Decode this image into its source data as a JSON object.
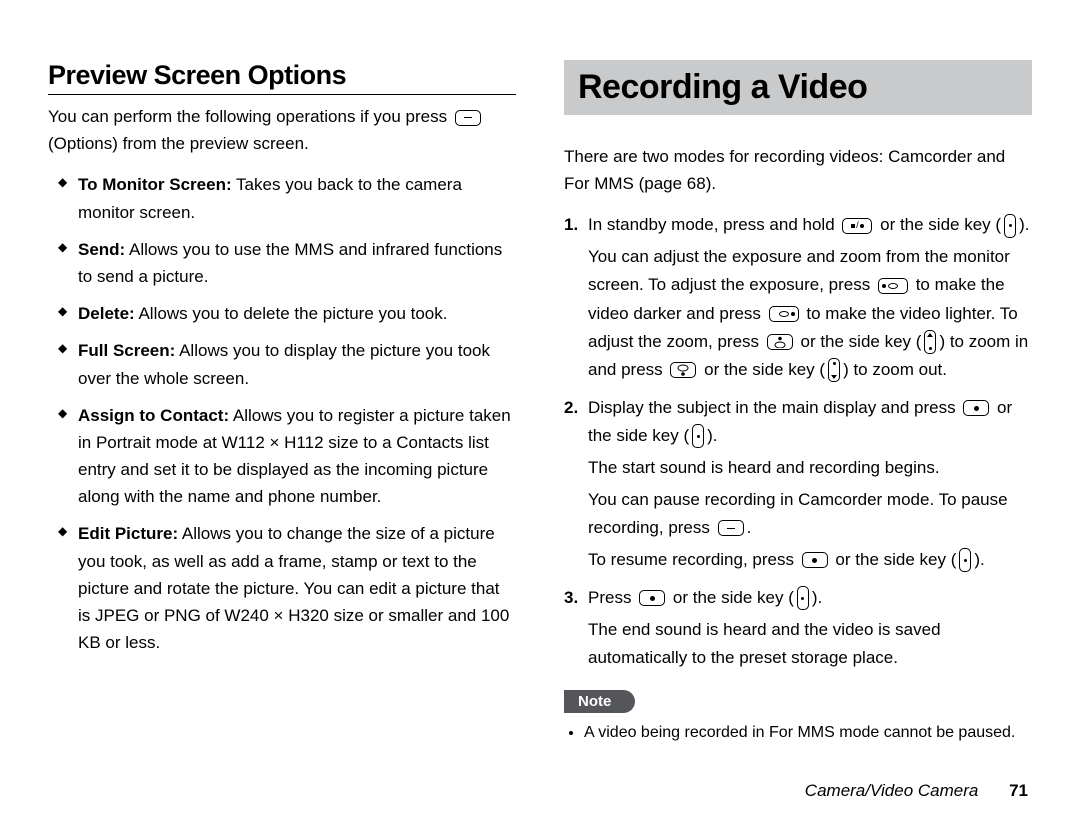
{
  "left": {
    "title": "Preview Screen Options",
    "intro_a": "You can perform the following operations if you press ",
    "intro_b": " (Options) from the preview screen.",
    "items": [
      {
        "label": "To Monitor Screen:",
        "text": " Takes you back to the camera monitor screen."
      },
      {
        "label": "Send:",
        "text": " Allows you to use the MMS and infrared functions to send a picture."
      },
      {
        "label": "Delete:",
        "text": " Allows you to delete the picture you took."
      },
      {
        "label": "Full Screen:",
        "text": " Allows you to display the picture you took over the whole screen."
      },
      {
        "label": "Assign to Contact:",
        "text": " Allows you to register a picture taken in Portrait mode at W112 × H112 size to a Contacts list entry and set it to be displayed as the incoming picture along with the name and phone number."
      },
      {
        "label": "Edit Picture:",
        "text": " Allows you to change the size of a picture you took, as well as add a frame, stamp or text to the picture and rotate the picture. You can edit a picture that is JPEG or PNG of W240 × H320 size or smaller and 100 KB or less."
      }
    ]
  },
  "right": {
    "title": "Recording a Video",
    "intro": "There are two modes for recording videos: Camcorder and For MMS (page 68).",
    "s1_a": "In standby mode, press and hold ",
    "s1_b": " or the side key (",
    "s1_c": ").",
    "s1_p2_a": "You can adjust the exposure and zoom from the monitor screen. To adjust the exposure, press ",
    "s1_p2_b": " to make the video darker and press ",
    "s1_p2_c": " to make the video lighter. To adjust the zoom, press ",
    "s1_p2_d": " or the side key (",
    "s1_p2_e": ") to zoom in and press ",
    "s1_p2_f": " or the side key (",
    "s1_p2_g": ") to zoom out.",
    "s2_a": "Display the subject in the main display and press ",
    "s2_b": " or the side key (",
    "s2_c": ").",
    "s2_p2": "The start sound is heard and recording begins.",
    "s2_p3_a": "You can pause recording in Camcorder mode. To pause recording, press ",
    "s2_p3_b": ".",
    "s2_p4_a": "To resume recording, press ",
    "s2_p4_b": " or the side key (",
    "s2_p4_c": ").",
    "s3_a": "Press ",
    "s3_b": " or the side key (",
    "s3_c": ").",
    "s3_p2": "The end sound is heard and the video is saved automatically to the preset storage place.",
    "note_label": "Note",
    "note_text": "A video being recorded in For MMS mode cannot be paused."
  },
  "footer": {
    "section": "Camera/Video Camera",
    "page": "71"
  }
}
